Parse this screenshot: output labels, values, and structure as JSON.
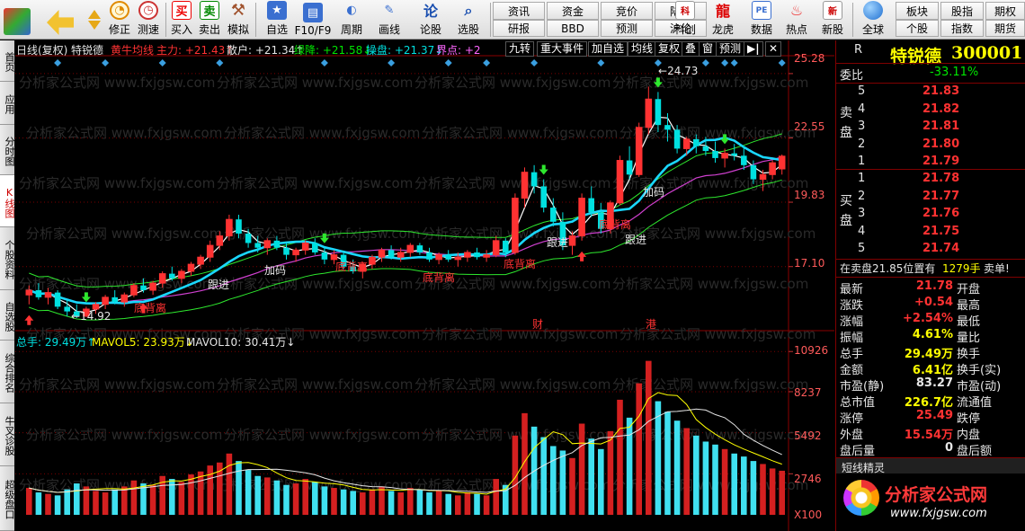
{
  "toolbar": {
    "buttons": [
      {
        "label": "修正"
      },
      {
        "label": "测速"
      },
      {
        "label": "买入"
      },
      {
        "label": "卖出"
      },
      {
        "label": "模拟"
      },
      {
        "label": "自选"
      },
      {
        "label": "F10/F9"
      },
      {
        "label": "周期"
      },
      {
        "label": "画线"
      },
      {
        "label": "论股"
      },
      {
        "label": "选股"
      }
    ],
    "pair_top": [
      "资讯",
      "资金",
      "竞价",
      "陆港"
    ],
    "pair_bottom": [
      "研报",
      "BBD",
      "预测",
      "沪伦"
    ],
    "right_buttons": [
      {
        "label": "科创"
      },
      {
        "label": "龙虎"
      },
      {
        "label": "数据"
      },
      {
        "label": "热点"
      },
      {
        "label": "新股"
      },
      {
        "label": "全球"
      }
    ],
    "right_top": [
      "板块",
      "股指",
      "期权"
    ],
    "right_bottom": [
      "个股",
      "指数",
      "期货"
    ]
  },
  "left_tabs": [
    "首页",
    "应用",
    "分时图",
    "K线图",
    "个股资料",
    "自选股",
    "综合排名",
    "牛叉诊股",
    "超级盘口"
  ],
  "chart_header": {
    "period": "日线(复权)",
    "stock": "特锐德",
    "indicator": "黄牛均线",
    "main": "主力: +21.43↑",
    "retail": "散户: +21.34↑",
    "green_line": "绿降: +21.58↓",
    "operate": "操盘: +21.37↓",
    "boundary": "界点: +2",
    "menu": [
      "九转",
      "重大事件",
      "加自选",
      "均线",
      "复权",
      "叠",
      "窗",
      "预测"
    ],
    "nav_icon": "play-forward-icon",
    "close_icon": "close-icon"
  },
  "price_axis": [
    "25.28",
    "22.55",
    "19.83",
    "17.10"
  ],
  "volume_header": {
    "total": "总手: 29.49万↑",
    "ma5": "MAVOL5: 23.93万↓",
    "ma10": "MAVOL10: 30.41万↓"
  },
  "volume_axis": [
    "10926",
    "8237",
    "5492",
    "2746",
    "X100"
  ],
  "annotations": {
    "high": "24.73",
    "low": "14.92",
    "signal_labels": [
      "底背离",
      "跟进",
      "加码",
      "底背离",
      "底背离",
      "跟进",
      "底背离",
      "跟进",
      "加码"
    ],
    "event_markers": [
      "财",
      "港"
    ],
    "watermark": "分析家公式网 www.fxjgsw.com"
  },
  "quote_panel": {
    "flag": "R",
    "name": "特锐德",
    "code": "300001",
    "wei_bi_label": "委比",
    "wei_bi_value": "-33.11%",
    "sell_label": "卖盘",
    "buy_label": "买盘",
    "sell": [
      {
        "level": "5",
        "price": "21.83"
      },
      {
        "level": "4",
        "price": "21.82"
      },
      {
        "level": "3",
        "price": "21.81"
      },
      {
        "level": "2",
        "price": "21.80"
      },
      {
        "level": "1",
        "price": "21.79"
      }
    ],
    "buy": [
      {
        "level": "1",
        "price": "21.78"
      },
      {
        "level": "2",
        "price": "21.77"
      },
      {
        "level": "3",
        "price": "21.76"
      },
      {
        "level": "4",
        "price": "21.75"
      },
      {
        "level": "5",
        "price": "21.74"
      }
    ],
    "notice_left": "在卖盘21.85位置有",
    "notice_qty": "1279手",
    "notice_right": "卖单!",
    "stats": [
      {
        "l": "最新",
        "v": "21.78",
        "r": "开盘"
      },
      {
        "l": "涨跌",
        "v": "+0.54",
        "r": "最高"
      },
      {
        "l": "涨幅",
        "v": "+2.54%",
        "r": "最低"
      },
      {
        "l": "振幅",
        "v": "4.61%",
        "r": "量比"
      },
      {
        "l": "总手",
        "v": "29.49万",
        "r": "换手"
      },
      {
        "l": "金额",
        "v": "6.41亿",
        "r": "换手(实)"
      },
      {
        "l": "市盈(静)",
        "v": "83.27",
        "r": "市盈(动)"
      },
      {
        "l": "总市值",
        "v": "226.7亿",
        "r": "流通值"
      },
      {
        "l": "涨停",
        "v": "25.49",
        "r": "跌停"
      },
      {
        "l": "外盘",
        "v": "15.54万",
        "r": "内盘"
      },
      {
        "l": "盘后量",
        "v": "0",
        "r": "盘后额"
      }
    ],
    "short_section": "短线精灵",
    "logo_text": "分析家公式网",
    "logo_url": "www.fxjgsw.com"
  },
  "colors": {
    "up": "#ff3232",
    "down": "#00e0e0",
    "accent": "#ffff00",
    "purple": "#ff00ff",
    "ma_cyan": "#00ffff",
    "ma_green": "#2ee82e"
  },
  "chart_data": {
    "type": "candlestick",
    "price_ylim": [
      14.5,
      26.0
    ],
    "price_ticks": [
      25.28,
      22.55,
      19.83,
      17.1
    ],
    "volume_ticks": [
      10926,
      8237,
      5492,
      2746
    ],
    "volume_unit": "X100",
    "high_mark": 24.73,
    "low_mark": 14.92,
    "candles": [
      [
        15.9,
        16.3,
        15.5,
        16.1
      ],
      [
        16.1,
        16.4,
        15.7,
        15.8
      ],
      [
        15.8,
        16.2,
        15.5,
        16.0
      ],
      [
        16.0,
        16.1,
        15.3,
        15.4
      ],
      [
        15.4,
        15.7,
        15.0,
        15.2
      ],
      [
        15.2,
        15.5,
        14.92,
        15.0
      ],
      [
        15.0,
        15.4,
        14.95,
        15.3
      ],
      [
        15.3,
        15.6,
        15.1,
        15.5
      ],
      [
        15.5,
        15.9,
        15.3,
        15.8
      ],
      [
        15.8,
        16.1,
        15.5,
        15.6
      ],
      [
        15.6,
        16.0,
        15.4,
        15.9
      ],
      [
        15.9,
        16.4,
        15.8,
        16.3
      ],
      [
        16.3,
        16.6,
        16.0,
        16.1
      ],
      [
        16.1,
        16.5,
        15.9,
        16.4
      ],
      [
        16.4,
        16.9,
        16.2,
        16.8
      ],
      [
        16.8,
        17.1,
        16.5,
        16.6
      ],
      [
        16.6,
        17.0,
        16.4,
        16.9
      ],
      [
        16.9,
        17.3,
        16.7,
        17.2
      ],
      [
        17.2,
        17.6,
        17.0,
        17.5
      ],
      [
        17.5,
        18.2,
        17.3,
        18.0
      ],
      [
        18.0,
        18.6,
        17.8,
        18.4
      ],
      [
        18.4,
        19.3,
        18.2,
        19.1
      ],
      [
        19.1,
        19.3,
        18.3,
        18.5
      ],
      [
        18.5,
        18.7,
        17.9,
        18.1
      ],
      [
        18.1,
        18.4,
        17.7,
        17.9
      ],
      [
        17.9,
        18.3,
        17.6,
        18.2
      ],
      [
        18.2,
        18.4,
        17.8,
        17.9
      ],
      [
        17.9,
        18.1,
        17.4,
        17.6
      ],
      [
        17.6,
        17.9,
        17.3,
        17.8
      ],
      [
        17.8,
        18.2,
        17.6,
        18.1
      ],
      [
        18.1,
        18.3,
        17.6,
        17.7
      ],
      [
        17.7,
        17.9,
        17.2,
        17.4
      ],
      [
        17.4,
        17.8,
        17.2,
        17.6
      ],
      [
        17.6,
        17.7,
        17.0,
        17.1
      ],
      [
        17.1,
        17.4,
        16.8,
        16.9
      ],
      [
        16.9,
        17.3,
        16.6,
        17.2
      ],
      [
        17.2,
        17.6,
        17.0,
        17.5
      ],
      [
        17.5,
        17.9,
        17.3,
        17.8
      ],
      [
        17.8,
        18.0,
        17.4,
        17.5
      ],
      [
        17.5,
        17.9,
        17.3,
        17.7
      ],
      [
        17.7,
        18.1,
        17.5,
        18.0
      ],
      [
        18.0,
        18.1,
        17.6,
        17.7
      ],
      [
        17.7,
        17.9,
        17.3,
        17.4
      ],
      [
        17.4,
        17.7,
        17.2,
        17.6
      ],
      [
        17.6,
        17.8,
        17.3,
        17.4
      ],
      [
        17.4,
        17.7,
        17.1,
        17.5
      ],
      [
        17.5,
        17.8,
        17.3,
        17.7
      ],
      [
        17.7,
        17.9,
        17.4,
        17.5
      ],
      [
        17.5,
        17.8,
        17.3,
        17.6
      ],
      [
        17.6,
        18.4,
        17.5,
        18.2
      ],
      [
        18.2,
        18.3,
        17.5,
        17.7
      ],
      [
        17.7,
        20.2,
        17.6,
        20.0
      ],
      [
        20.0,
        21.3,
        19.6,
        21.1
      ],
      [
        21.1,
        21.4,
        20.2,
        20.5
      ],
      [
        20.5,
        20.8,
        19.4,
        19.6
      ],
      [
        19.6,
        20.0,
        18.8,
        19.0
      ],
      [
        19.0,
        19.4,
        17.8,
        18.0
      ],
      [
        18.0,
        18.6,
        17.6,
        18.4
      ],
      [
        18.4,
        20.2,
        18.2,
        20.0
      ],
      [
        20.0,
        20.5,
        19.2,
        19.4
      ],
      [
        19.4,
        19.8,
        18.5,
        18.7
      ],
      [
        18.7,
        19.9,
        18.5,
        19.8
      ],
      [
        19.8,
        21.8,
        19.7,
        21.6
      ],
      [
        21.6,
        22.2,
        20.8,
        21.0
      ],
      [
        21.0,
        23.2,
        20.9,
        23.0
      ],
      [
        23.0,
        24.73,
        22.7,
        24.2
      ],
      [
        24.2,
        24.5,
        22.8,
        23.1
      ],
      [
        23.1,
        23.6,
        22.4,
        22.9
      ],
      [
        22.9,
        23.1,
        21.9,
        22.1
      ],
      [
        22.1,
        22.6,
        21.8,
        22.5
      ],
      [
        22.5,
        22.7,
        21.9,
        22.2
      ],
      [
        22.2,
        22.6,
        21.8,
        22.0
      ],
      [
        22.0,
        22.4,
        21.5,
        21.7
      ],
      [
        21.7,
        22.1,
        21.3,
        21.9
      ],
      [
        21.9,
        22.3,
        21.6,
        21.8
      ],
      [
        21.8,
        22.2,
        21.2,
        21.4
      ],
      [
        21.4,
        21.6,
        20.6,
        20.8
      ],
      [
        20.8,
        21.2,
        20.3,
        21.0
      ],
      [
        21.0,
        21.6,
        20.8,
        21.5
      ],
      [
        21.24,
        21.85,
        21.0,
        21.78
      ]
    ],
    "volumes": [
      1800,
      1500,
      1400,
      1300,
      1700,
      2100,
      1900,
      1600,
      1500,
      1700,
      1900,
      2300,
      2100,
      2000,
      2600,
      2400,
      2200,
      2700,
      2900,
      3300,
      3500,
      4100,
      3600,
      3000,
      2600,
      2500,
      2300,
      2000,
      2100,
      2400,
      2200,
      1900,
      1800,
      1700,
      1600,
      1500,
      1700,
      1900,
      1600,
      1500,
      1800,
      1700,
      1500,
      1600,
      1400,
      1300,
      1500,
      1400,
      1300,
      2400,
      2000,
      5300,
      6800,
      5900,
      5200,
      4600,
      4300,
      3800,
      6100,
      5100,
      4400,
      5600,
      7700,
      6500,
      8800,
      10300,
      7600,
      6900,
      6300,
      5800,
      5300,
      4900,
      4700,
      4400,
      4100,
      3900,
      3600,
      3400,
      3100,
      2949
    ],
    "ma_main": "主力",
    "ma_retail": "散户"
  }
}
